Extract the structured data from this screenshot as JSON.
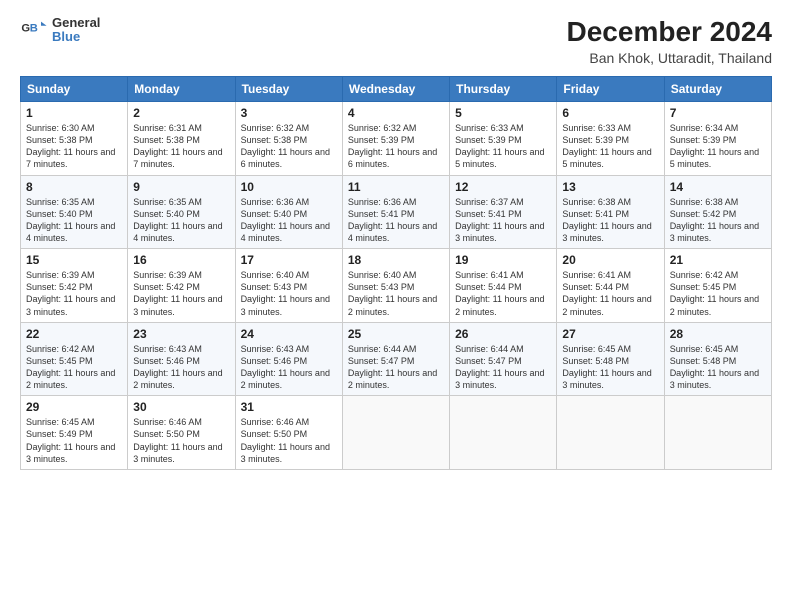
{
  "logo": {
    "line1": "General",
    "line2": "Blue"
  },
  "title": "December 2024",
  "subtitle": "Ban Khok, Uttaradit, Thailand",
  "header_days": [
    "Sunday",
    "Monday",
    "Tuesday",
    "Wednesday",
    "Thursday",
    "Friday",
    "Saturday"
  ],
  "weeks": [
    [
      {
        "day": "1",
        "sunrise": "6:30 AM",
        "sunset": "5:38 PM",
        "daylight": "11 hours and 7 minutes."
      },
      {
        "day": "2",
        "sunrise": "6:31 AM",
        "sunset": "5:38 PM",
        "daylight": "11 hours and 7 minutes."
      },
      {
        "day": "3",
        "sunrise": "6:32 AM",
        "sunset": "5:38 PM",
        "daylight": "11 hours and 6 minutes."
      },
      {
        "day": "4",
        "sunrise": "6:32 AM",
        "sunset": "5:39 PM",
        "daylight": "11 hours and 6 minutes."
      },
      {
        "day": "5",
        "sunrise": "6:33 AM",
        "sunset": "5:39 PM",
        "daylight": "11 hours and 5 minutes."
      },
      {
        "day": "6",
        "sunrise": "6:33 AM",
        "sunset": "5:39 PM",
        "daylight": "11 hours and 5 minutes."
      },
      {
        "day": "7",
        "sunrise": "6:34 AM",
        "sunset": "5:39 PM",
        "daylight": "11 hours and 5 minutes."
      }
    ],
    [
      {
        "day": "8",
        "sunrise": "6:35 AM",
        "sunset": "5:40 PM",
        "daylight": "11 hours and 4 minutes."
      },
      {
        "day": "9",
        "sunrise": "6:35 AM",
        "sunset": "5:40 PM",
        "daylight": "11 hours and 4 minutes."
      },
      {
        "day": "10",
        "sunrise": "6:36 AM",
        "sunset": "5:40 PM",
        "daylight": "11 hours and 4 minutes."
      },
      {
        "day": "11",
        "sunrise": "6:36 AM",
        "sunset": "5:41 PM",
        "daylight": "11 hours and 4 minutes."
      },
      {
        "day": "12",
        "sunrise": "6:37 AM",
        "sunset": "5:41 PM",
        "daylight": "11 hours and 3 minutes."
      },
      {
        "day": "13",
        "sunrise": "6:38 AM",
        "sunset": "5:41 PM",
        "daylight": "11 hours and 3 minutes."
      },
      {
        "day": "14",
        "sunrise": "6:38 AM",
        "sunset": "5:42 PM",
        "daylight": "11 hours and 3 minutes."
      }
    ],
    [
      {
        "day": "15",
        "sunrise": "6:39 AM",
        "sunset": "5:42 PM",
        "daylight": "11 hours and 3 minutes."
      },
      {
        "day": "16",
        "sunrise": "6:39 AM",
        "sunset": "5:42 PM",
        "daylight": "11 hours and 3 minutes."
      },
      {
        "day": "17",
        "sunrise": "6:40 AM",
        "sunset": "5:43 PM",
        "daylight": "11 hours and 3 minutes."
      },
      {
        "day": "18",
        "sunrise": "6:40 AM",
        "sunset": "5:43 PM",
        "daylight": "11 hours and 2 minutes."
      },
      {
        "day": "19",
        "sunrise": "6:41 AM",
        "sunset": "5:44 PM",
        "daylight": "11 hours and 2 minutes."
      },
      {
        "day": "20",
        "sunrise": "6:41 AM",
        "sunset": "5:44 PM",
        "daylight": "11 hours and 2 minutes."
      },
      {
        "day": "21",
        "sunrise": "6:42 AM",
        "sunset": "5:45 PM",
        "daylight": "11 hours and 2 minutes."
      }
    ],
    [
      {
        "day": "22",
        "sunrise": "6:42 AM",
        "sunset": "5:45 PM",
        "daylight": "11 hours and 2 minutes."
      },
      {
        "day": "23",
        "sunrise": "6:43 AM",
        "sunset": "5:46 PM",
        "daylight": "11 hours and 2 minutes."
      },
      {
        "day": "24",
        "sunrise": "6:43 AM",
        "sunset": "5:46 PM",
        "daylight": "11 hours and 2 minutes."
      },
      {
        "day": "25",
        "sunrise": "6:44 AM",
        "sunset": "5:47 PM",
        "daylight": "11 hours and 2 minutes."
      },
      {
        "day": "26",
        "sunrise": "6:44 AM",
        "sunset": "5:47 PM",
        "daylight": "11 hours and 3 minutes."
      },
      {
        "day": "27",
        "sunrise": "6:45 AM",
        "sunset": "5:48 PM",
        "daylight": "11 hours and 3 minutes."
      },
      {
        "day": "28",
        "sunrise": "6:45 AM",
        "sunset": "5:48 PM",
        "daylight": "11 hours and 3 minutes."
      }
    ],
    [
      {
        "day": "29",
        "sunrise": "6:45 AM",
        "sunset": "5:49 PM",
        "daylight": "11 hours and 3 minutes."
      },
      {
        "day": "30",
        "sunrise": "6:46 AM",
        "sunset": "5:50 PM",
        "daylight": "11 hours and 3 minutes."
      },
      {
        "day": "31",
        "sunrise": "6:46 AM",
        "sunset": "5:50 PM",
        "daylight": "11 hours and 3 minutes."
      },
      null,
      null,
      null,
      null
    ]
  ]
}
